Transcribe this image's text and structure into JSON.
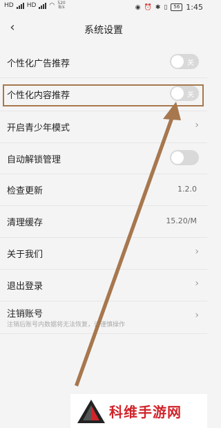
{
  "status": {
    "carrier_left": "HD",
    "speed_value": "520",
    "speed_unit": "B/s",
    "battery": "56",
    "time": "1:45"
  },
  "header": {
    "title": "系统设置"
  },
  "settings": {
    "ad_recommend": {
      "label": "个性化广告推荐",
      "toggle": "关"
    },
    "content_recommend": {
      "label": "个性化内容推荐",
      "toggle": "关"
    },
    "teen_mode": {
      "label": "开启青少年模式"
    },
    "auto_unlock": {
      "label": "自动解锁管理"
    },
    "check_update": {
      "label": "检查更新",
      "value": "1.2.0"
    },
    "clear_cache": {
      "label": "清理缓存",
      "value": "15.20/M"
    },
    "about": {
      "label": "关于我们"
    },
    "logout": {
      "label": "退出登录"
    },
    "cancel_account": {
      "label": "注销账号",
      "sub": "注销后账号内数据将无法恢复，请谨慎操作"
    }
  },
  "watermark": {
    "text": "科维手游网"
  },
  "colors": {
    "highlight": "#a7774e",
    "watermark_red": "#d0242b",
    "toggle_off": "#d9d9d9"
  }
}
